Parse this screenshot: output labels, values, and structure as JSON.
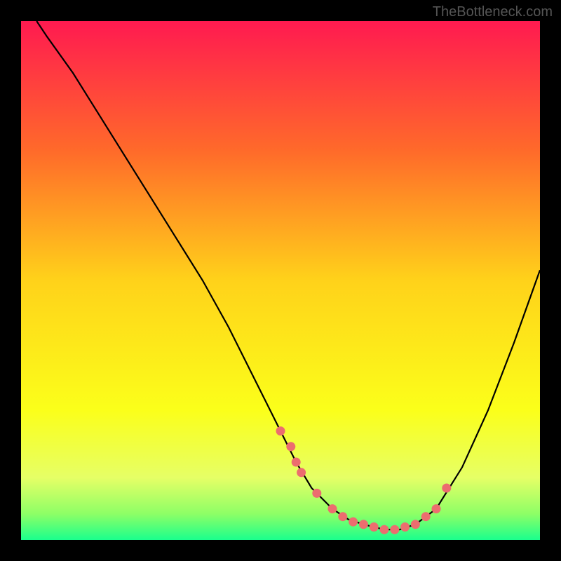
{
  "watermark": "TheBottleneck.com",
  "chart_data": {
    "type": "line",
    "title": "",
    "xlabel": "",
    "ylabel": "",
    "xlim": [
      0,
      100
    ],
    "ylim": [
      0,
      100
    ],
    "series": [
      {
        "name": "curve",
        "x": [
          3,
          5,
          10,
          15,
          20,
          25,
          30,
          35,
          40,
          45,
          50,
          53,
          56,
          60,
          63,
          66,
          70,
          73,
          76,
          80,
          85,
          90,
          95,
          100
        ],
        "y": [
          100,
          97,
          90,
          82,
          74,
          66,
          58,
          50,
          41,
          31,
          21,
          15,
          10,
          6,
          4,
          3,
          2,
          2,
          3,
          6,
          14,
          25,
          38,
          52
        ]
      }
    ],
    "markers": {
      "name": "datapoints",
      "color": "#ec6d6f",
      "x": [
        50,
        52,
        53,
        54,
        57,
        60,
        62,
        64,
        66,
        68,
        70,
        72,
        74,
        76,
        78,
        80,
        82
      ],
      "y": [
        21,
        18,
        15,
        13,
        9,
        6,
        4.5,
        3.5,
        3,
        2.5,
        2,
        2,
        2.5,
        3,
        4.5,
        6,
        10
      ]
    },
    "background_gradient": {
      "stops": [
        {
          "pos": 0.0,
          "color": "#ff1a50"
        },
        {
          "pos": 0.25,
          "color": "#ff6a2a"
        },
        {
          "pos": 0.5,
          "color": "#ffd21a"
        },
        {
          "pos": 0.75,
          "color": "#fbff1a"
        },
        {
          "pos": 0.88,
          "color": "#e6ff66"
        },
        {
          "pos": 0.95,
          "color": "#8dff66"
        },
        {
          "pos": 1.0,
          "color": "#1aff8d"
        }
      ]
    }
  }
}
